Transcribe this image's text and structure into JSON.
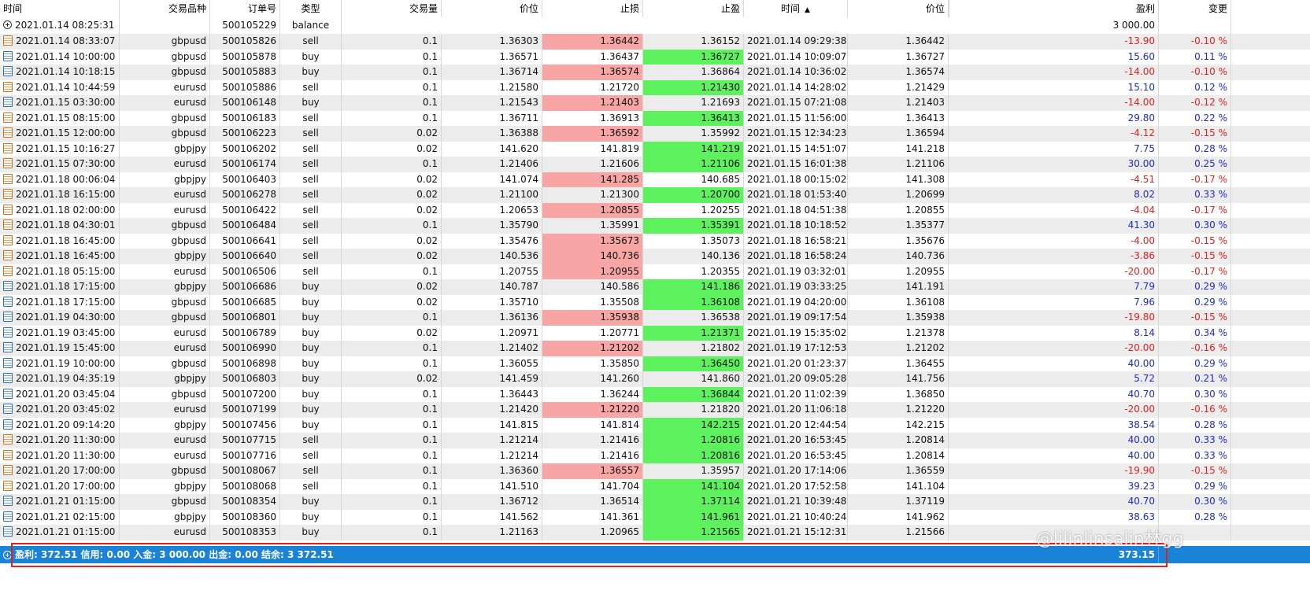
{
  "columns": [
    "时间",
    "交易品种",
    "订单号",
    "类型",
    "交易量",
    "价位",
    "止损",
    "止盈",
    "时间",
    "价位",
    "",
    "盈利",
    "变更"
  ],
  "balance_row": {
    "time": "2021.01.14 08:25:31",
    "order": "500105229",
    "type": "balance",
    "profit": "3 000.00"
  },
  "rows": [
    {
      "t": "2021.01.14 08:33:07",
      "sym": "gbpusd",
      "ord": "500105826",
      "type": "sell",
      "vol": "0.1",
      "price": "1.36303",
      "sl": "1.36442",
      "tp": "1.36152",
      "ct": "2021.01.14 09:29:38",
      "cp": "1.36442",
      "profit": "-13.90",
      "chg": "-0.10 %",
      "hit": "sl"
    },
    {
      "t": "2021.01.14 10:00:00",
      "sym": "gbpusd",
      "ord": "500105878",
      "type": "buy",
      "vol": "0.1",
      "price": "1.36571",
      "sl": "1.36437",
      "tp": "1.36727",
      "ct": "2021.01.14 10:09:07",
      "cp": "1.36727",
      "profit": "15.60",
      "chg": "0.11 %",
      "hit": "tp"
    },
    {
      "t": "2021.01.14 10:18:15",
      "sym": "gbpusd",
      "ord": "500105883",
      "type": "buy",
      "vol": "0.1",
      "price": "1.36714",
      "sl": "1.36574",
      "tp": "1.36864",
      "ct": "2021.01.14 10:36:02",
      "cp": "1.36574",
      "profit": "-14.00",
      "chg": "-0.10 %",
      "hit": "sl"
    },
    {
      "t": "2021.01.14 10:44:59",
      "sym": "eurusd",
      "ord": "500105886",
      "type": "sell",
      "vol": "0.1",
      "price": "1.21580",
      "sl": "1.21720",
      "tp": "1.21430",
      "ct": "2021.01.14 14:28:02",
      "cp": "1.21429",
      "profit": "15.10",
      "chg": "0.12 %",
      "hit": "tp"
    },
    {
      "t": "2021.01.15 03:30:00",
      "sym": "eurusd",
      "ord": "500106148",
      "type": "buy",
      "vol": "0.1",
      "price": "1.21543",
      "sl": "1.21403",
      "tp": "1.21693",
      "ct": "2021.01.15 07:21:08",
      "cp": "1.21403",
      "profit": "-14.00",
      "chg": "-0.12 %",
      "hit": "sl"
    },
    {
      "t": "2021.01.15 08:15:00",
      "sym": "gbpusd",
      "ord": "500106183",
      "type": "sell",
      "vol": "0.1",
      "price": "1.36711",
      "sl": "1.36913",
      "tp": "1.36413",
      "ct": "2021.01.15 11:56:00",
      "cp": "1.36413",
      "profit": "29.80",
      "chg": "0.22 %",
      "hit": "tp"
    },
    {
      "t": "2021.01.15 12:00:00",
      "sym": "gbpusd",
      "ord": "500106223",
      "type": "sell",
      "vol": "0.02",
      "price": "1.36388",
      "sl": "1.36592",
      "tp": "1.35992",
      "ct": "2021.01.15 12:34:23",
      "cp": "1.36594",
      "profit": "-4.12",
      "chg": "-0.15 %",
      "hit": "sl"
    },
    {
      "t": "2021.01.15 10:16:27",
      "sym": "gbpjpy",
      "ord": "500106202",
      "type": "sell",
      "vol": "0.02",
      "price": "141.620",
      "sl": "141.819",
      "tp": "141.219",
      "ct": "2021.01.15 14:51:07",
      "cp": "141.218",
      "profit": "7.75",
      "chg": "0.28 %",
      "hit": "tp"
    },
    {
      "t": "2021.01.15 07:30:00",
      "sym": "eurusd",
      "ord": "500106174",
      "type": "sell",
      "vol": "0.1",
      "price": "1.21406",
      "sl": "1.21606",
      "tp": "1.21106",
      "ct": "2021.01.15 16:01:38",
      "cp": "1.21106",
      "profit": "30.00",
      "chg": "0.25 %",
      "hit": "tp"
    },
    {
      "t": "2021.01.18 00:06:04",
      "sym": "gbpjpy",
      "ord": "500106403",
      "type": "sell",
      "vol": "0.02",
      "price": "141.074",
      "sl": "141.285",
      "tp": "140.685",
      "ct": "2021.01.18 00:15:02",
      "cp": "141.308",
      "profit": "-4.51",
      "chg": "-0.17 %",
      "hit": "sl"
    },
    {
      "t": "2021.01.18 16:15:00",
      "sym": "eurusd",
      "ord": "500106278",
      "type": "sell",
      "vol": "0.02",
      "price": "1.21100",
      "sl": "1.21300",
      "tp": "1.20700",
      "ct": "2021.01.18 01:53:40",
      "cp": "1.20699",
      "profit": "8.02",
      "chg": "0.33 %",
      "hit": "tp"
    },
    {
      "t": "2021.01.18 02:00:00",
      "sym": "eurusd",
      "ord": "500106422",
      "type": "sell",
      "vol": "0.02",
      "price": "1.20653",
      "sl": "1.20855",
      "tp": "1.20255",
      "ct": "2021.01.18 04:51:38",
      "cp": "1.20855",
      "profit": "-4.04",
      "chg": "-0.17 %",
      "hit": "sl"
    },
    {
      "t": "2021.01.18 04:30:01",
      "sym": "gbpusd",
      "ord": "500106484",
      "type": "sell",
      "vol": "0.1",
      "price": "1.35790",
      "sl": "1.35991",
      "tp": "1.35391",
      "ct": "2021.01.18 10:18:52",
      "cp": "1.35377",
      "profit": "41.30",
      "chg": "0.30 %",
      "hit": "tp"
    },
    {
      "t": "2021.01.18 16:45:00",
      "sym": "gbpusd",
      "ord": "500106641",
      "type": "sell",
      "vol": "0.02",
      "price": "1.35476",
      "sl": "1.35673",
      "tp": "1.35073",
      "ct": "2021.01.18 16:58:21",
      "cp": "1.35676",
      "profit": "-4.00",
      "chg": "-0.15 %",
      "hit": "sl"
    },
    {
      "t": "2021.01.18 16:45:00",
      "sym": "gbpjpy",
      "ord": "500106640",
      "type": "sell",
      "vol": "0.02",
      "price": "140.536",
      "sl": "140.736",
      "tp": "140.136",
      "ct": "2021.01.18 16:58:24",
      "cp": "140.736",
      "profit": "-3.86",
      "chg": "-0.15 %",
      "hit": "sl"
    },
    {
      "t": "2021.01.18 05:15:00",
      "sym": "eurusd",
      "ord": "500106506",
      "type": "sell",
      "vol": "0.1",
      "price": "1.20755",
      "sl": "1.20955",
      "tp": "1.20355",
      "ct": "2021.01.19 03:32:01",
      "cp": "1.20955",
      "profit": "-20.00",
      "chg": "-0.17 %",
      "hit": "sl"
    },
    {
      "t": "2021.01.18 17:15:00",
      "sym": "gbpjpy",
      "ord": "500106686",
      "type": "buy",
      "vol": "0.02",
      "price": "140.787",
      "sl": "140.586",
      "tp": "141.186",
      "ct": "2021.01.19 03:33:25",
      "cp": "141.191",
      "profit": "7.79",
      "chg": "0.29 %",
      "hit": "tp"
    },
    {
      "t": "2021.01.18 17:15:00",
      "sym": "gbpusd",
      "ord": "500106685",
      "type": "buy",
      "vol": "0.02",
      "price": "1.35710",
      "sl": "1.35508",
      "tp": "1.36108",
      "ct": "2021.01.19 04:20:00",
      "cp": "1.36108",
      "profit": "7.96",
      "chg": "0.29 %",
      "hit": "tp"
    },
    {
      "t": "2021.01.19 04:30:00",
      "sym": "gbpusd",
      "ord": "500106801",
      "type": "buy",
      "vol": "0.1",
      "price": "1.36136",
      "sl": "1.35938",
      "tp": "1.36538",
      "ct": "2021.01.19 09:17:54",
      "cp": "1.35938",
      "profit": "-19.80",
      "chg": "-0.15 %",
      "hit": "sl"
    },
    {
      "t": "2021.01.19 03:45:00",
      "sym": "eurusd",
      "ord": "500106789",
      "type": "buy",
      "vol": "0.02",
      "price": "1.20971",
      "sl": "1.20771",
      "tp": "1.21371",
      "ct": "2021.01.19 15:35:02",
      "cp": "1.21378",
      "profit": "8.14",
      "chg": "0.34 %",
      "hit": "tp"
    },
    {
      "t": "2021.01.19 15:45:00",
      "sym": "eurusd",
      "ord": "500106990",
      "type": "buy",
      "vol": "0.1",
      "price": "1.21402",
      "sl": "1.21202",
      "tp": "1.21802",
      "ct": "2021.01.19 17:12:53",
      "cp": "1.21202",
      "profit": "-20.00",
      "chg": "-0.16 %",
      "hit": "sl"
    },
    {
      "t": "2021.01.19 10:00:00",
      "sym": "gbpusd",
      "ord": "500106898",
      "type": "buy",
      "vol": "0.1",
      "price": "1.36055",
      "sl": "1.35850",
      "tp": "1.36450",
      "ct": "2021.01.20 01:23:37",
      "cp": "1.36455",
      "profit": "40.00",
      "chg": "0.29 %",
      "hit": "tp"
    },
    {
      "t": "2021.01.19 04:35:19",
      "sym": "gbpjpy",
      "ord": "500106803",
      "type": "buy",
      "vol": "0.02",
      "price": "141.459",
      "sl": "141.260",
      "tp": "141.860",
      "ct": "2021.01.20 09:05:28",
      "cp": "141.756",
      "profit": "5.72",
      "chg": "0.21 %",
      "hit": ""
    },
    {
      "t": "2021.01.20 03:45:04",
      "sym": "gbpusd",
      "ord": "500107200",
      "type": "buy",
      "vol": "0.1",
      "price": "1.36443",
      "sl": "1.36244",
      "tp": "1.36844",
      "ct": "2021.01.20 11:02:39",
      "cp": "1.36850",
      "profit": "40.70",
      "chg": "0.30 %",
      "hit": "tp"
    },
    {
      "t": "2021.01.20 03:45:02",
      "sym": "eurusd",
      "ord": "500107199",
      "type": "buy",
      "vol": "0.1",
      "price": "1.21420",
      "sl": "1.21220",
      "tp": "1.21820",
      "ct": "2021.01.20 11:06:18",
      "cp": "1.21220",
      "profit": "-20.00",
      "chg": "-0.16 %",
      "hit": "sl"
    },
    {
      "t": "2021.01.20 09:14:20",
      "sym": "gbpjpy",
      "ord": "500107456",
      "type": "buy",
      "vol": "0.1",
      "price": "141.815",
      "sl": "141.814",
      "tp": "142.215",
      "ct": "2021.01.20 12:44:54",
      "cp": "142.215",
      "profit": "38.54",
      "chg": "0.28 %",
      "hit": "tp"
    },
    {
      "t": "2021.01.20 11:30:00",
      "sym": "eurusd",
      "ord": "500107715",
      "type": "sell",
      "vol": "0.1",
      "price": "1.21214",
      "sl": "1.21416",
      "tp": "1.20816",
      "ct": "2021.01.20 16:53:45",
      "cp": "1.20814",
      "profit": "40.00",
      "chg": "0.33 %",
      "hit": "tp"
    },
    {
      "t": "2021.01.20 11:30:00",
      "sym": "eurusd",
      "ord": "500107716",
      "type": "sell",
      "vol": "0.1",
      "price": "1.21214",
      "sl": "1.21416",
      "tp": "1.20816",
      "ct": "2021.01.20 16:53:45",
      "cp": "1.20814",
      "profit": "40.00",
      "chg": "0.33 %",
      "hit": "tp"
    },
    {
      "t": "2021.01.20 17:00:00",
      "sym": "gbpusd",
      "ord": "500108067",
      "type": "sell",
      "vol": "0.1",
      "price": "1.36360",
      "sl": "1.36557",
      "tp": "1.35957",
      "ct": "2021.01.20 17:14:06",
      "cp": "1.36559",
      "profit": "-19.90",
      "chg": "-0.15 %",
      "hit": "sl"
    },
    {
      "t": "2021.01.20 17:00:00",
      "sym": "gbpjpy",
      "ord": "500108068",
      "type": "sell",
      "vol": "0.1",
      "price": "141.510",
      "sl": "141.704",
      "tp": "141.104",
      "ct": "2021.01.20 17:52:58",
      "cp": "141.104",
      "profit": "39.23",
      "chg": "0.29 %",
      "hit": "tp"
    },
    {
      "t": "2021.01.21 01:15:00",
      "sym": "gbpusd",
      "ord": "500108354",
      "type": "buy",
      "vol": "0.1",
      "price": "1.36712",
      "sl": "1.36514",
      "tp": "1.37114",
      "ct": "2021.01.21 10:39:48",
      "cp": "1.37119",
      "profit": "40.70",
      "chg": "0.30 %",
      "hit": "tp"
    },
    {
      "t": "2021.01.21 02:15:00",
      "sym": "gbpjpy",
      "ord": "500108360",
      "type": "buy",
      "vol": "0.1",
      "price": "141.562",
      "sl": "141.361",
      "tp": "141.961",
      "ct": "2021.01.21 10:40:24",
      "cp": "141.962",
      "profit": "38.63",
      "chg": "0.28 %",
      "hit": "tp"
    },
    {
      "t": "2021.01.21 01:15:00",
      "sym": "eurusd",
      "ord": "500108353",
      "type": "buy",
      "vol": "0.1",
      "price": "1.21163",
      "sl": "1.20965",
      "tp": "1.21565",
      "ct": "2021.01.21 15:12:31",
      "cp": "1.21566",
      "profit": "",
      "chg": "",
      "hit": "tp"
    }
  ],
  "status": {
    "summary": "盈利: 372.51  信用: 0.00  入金: 3 000.00  出金: 0.00  结余: 3 372.51",
    "total_profit": "373.15"
  },
  "watermark": "@lilinlinsalin林gg",
  "colors": {
    "sl_hit": "#f7a5a5",
    "tp_hit": "#5ef15e",
    "positive": "#1f2ac8",
    "negative": "#e02020",
    "status_bar": "#1a83d8"
  }
}
